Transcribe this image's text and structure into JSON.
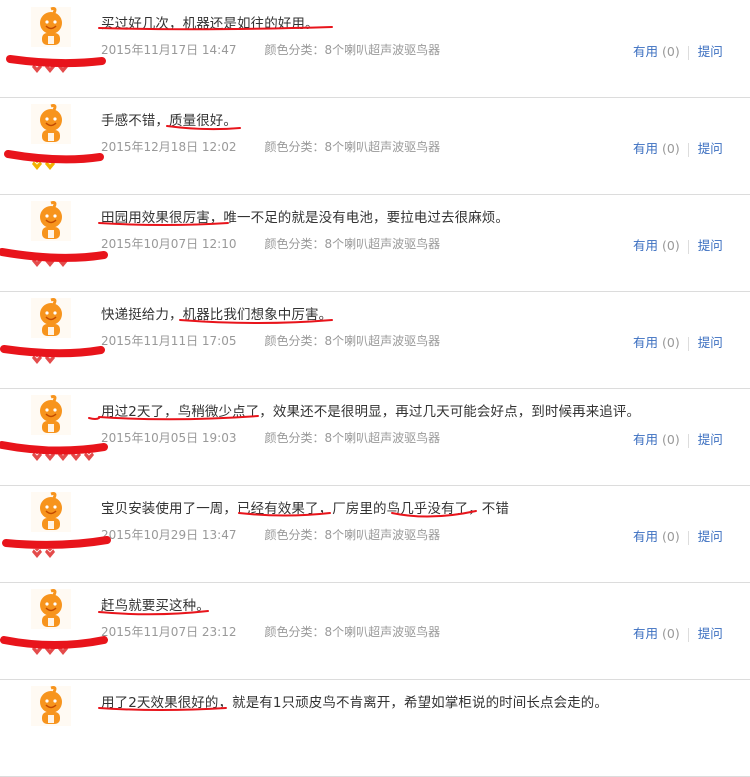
{
  "reviews": [
    {
      "text": "买过好几次，机器还是如往的好用。",
      "date": "2015年11月17日 14:47",
      "category": "颜色分类：8个喇叭超声波驱鸟器",
      "helpful_label": "有用",
      "helpful_count": "(0)",
      "ask_label": "提问",
      "badge_count": 3,
      "badge_color": "#e44b4b"
    },
    {
      "text": "手感不错，质量很好。",
      "date": "2015年12月18日 12:02",
      "category": "颜色分类：8个喇叭超声波驱鸟器",
      "helpful_label": "有用",
      "helpful_count": "(0)",
      "ask_label": "提问",
      "badge_count": 2,
      "badge_color": "#f2b200"
    },
    {
      "text": "田园用效果很厉害，唯一不足的就是没有电池，要拉电过去很麻烦。",
      "date": "2015年10月07日 12:10",
      "category": "颜色分类：8个喇叭超声波驱鸟器",
      "helpful_label": "有用",
      "helpful_count": "(0)",
      "ask_label": "提问",
      "badge_count": 3,
      "badge_color": "#e44b4b"
    },
    {
      "text": "快递挺给力，机器比我们想象中厉害。",
      "date": "2015年11月11日 17:05",
      "category": "颜色分类：8个喇叭超声波驱鸟器",
      "helpful_label": "有用",
      "helpful_count": "(0)",
      "ask_label": "提问",
      "badge_count": 2,
      "badge_color": "#e44b4b"
    },
    {
      "text": "用过2天了，鸟稍微少点了，效果还不是很明显，再过几天可能会好点，到时候再来追评。",
      "date": "2015年10月05日 19:03",
      "category": "颜色分类：8个喇叭超声波驱鸟器",
      "helpful_label": "有用",
      "helpful_count": "(0)",
      "ask_label": "提问",
      "badge_count": 5,
      "badge_color": "#e44b4b"
    },
    {
      "text": "宝贝安装使用了一周，已经有效果了，厂房里的鸟几乎没有了，不错",
      "date": "2015年10月29日 13:47",
      "category": "颜色分类：8个喇叭超声波驱鸟器",
      "helpful_label": "有用",
      "helpful_count": "(0)",
      "ask_label": "提问",
      "badge_count": 2,
      "badge_color": "#e44b4b"
    },
    {
      "text": "赶鸟就要买这种。",
      "date": "2015年11月07日 23:12",
      "category": "颜色分类：8个喇叭超声波驱鸟器",
      "helpful_label": "有用",
      "helpful_count": "(0)",
      "ask_label": "提问",
      "badge_count": 3,
      "badge_color": "#e44b4b"
    },
    {
      "text": "用了2天效果很好的，就是有1只顽皮鸟不肯离开，希望如掌柜说的时间长点会走的。",
      "date": "",
      "category": "",
      "helpful_label": "",
      "helpful_count": "",
      "ask_label": "",
      "badge_count": 0,
      "badge_color": "#e44b4b"
    }
  ],
  "colors": {
    "underline": "#e8141b",
    "link": "#3a6ec0",
    "muted": "#999999",
    "text": "#333333",
    "divider": "#dcdcdc",
    "avatar": "#f7941d"
  }
}
